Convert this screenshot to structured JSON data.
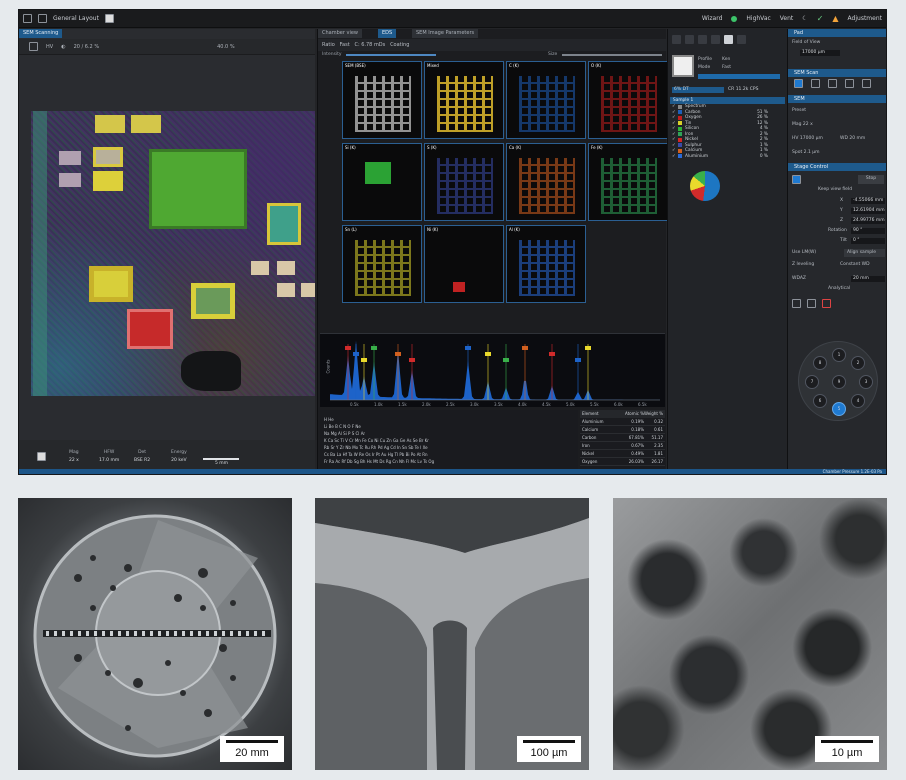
{
  "app": {
    "layout_label": "General Layout",
    "wizard_label": "Wizard",
    "highvac_label": "HighVac",
    "vent_label": "Vent",
    "adjustment_label": "Adjustment",
    "tabs": {
      "sem_scanning": "SEM Scanning",
      "chamber_view": "Chamber view",
      "eds": "EDS",
      "sem_image_params": "SEM Image Parameters"
    },
    "left_toolbar": {
      "hv_label": "HV",
      "magnification": "40.0 %",
      "spot": "20 / 6.2 %"
    },
    "left_status": [
      {
        "label": "Mag",
        "value": "22 x"
      },
      {
        "label": "HFW",
        "value": "17.0 mm"
      },
      {
        "label": "Det",
        "value": "BSE R2"
      },
      {
        "label": "Energy",
        "value": "20 keV"
      }
    ],
    "left_scalebar": "5 mm",
    "middle_toolbar": {
      "items": [
        "Ratio",
        "Fast",
        "C: 6.78 mDs",
        "Coating"
      ],
      "intensity_label": "Intensity",
      "size_label": "Size"
    },
    "map_tiles": [
      {
        "label": "SEM (BSE)",
        "color": "#9a9a9a"
      },
      {
        "label": "Mixed",
        "color": "#c9a92a"
      },
      {
        "label": "C (K)",
        "color": "#1f5fb8"
      },
      {
        "label": "O (K)",
        "color": "#c21e1e"
      },
      {
        "label": "Si (K)",
        "color": "#2fb338"
      },
      {
        "label": "S (K)",
        "color": "#3a4aa8"
      },
      {
        "label": "Ca (K)",
        "color": "#d2601f"
      },
      {
        "label": "Fe (K)",
        "color": "#2fa358"
      },
      {
        "label": "Sn (L)",
        "color": "#d9d02a"
      },
      {
        "label": "Ni (K)",
        "color": "#d42525"
      },
      {
        "label": "Al (K)",
        "color": "#2a6ad8"
      }
    ],
    "spectrum_ylabel": "Counts",
    "spectrum_ticks": [
      "0.5k",
      "1.0k",
      "1.5k",
      "2.0k",
      "2.5k",
      "3.0k",
      "3.5k",
      "4.0k",
      "4.5k",
      "5.0k",
      "5.5k",
      "6.0k",
      "6.5k"
    ],
    "periodic_rows": [
      "H He",
      "Li Be B C N O F Ne",
      "Na Mg Al Si P S Cl Ar",
      "K Ca Sc Ti V Cr Mn Fe Co Ni Cu Zn Ga Ge As Se Br Kr",
      "Rb Sr Y Zr Nb Mo Tc Ru Rh Pd Ag Cd In Sn Sb Te I Xe",
      "Cs Ba La Hf Ta W Re Os Ir Pt Au Hg Tl Pb Bi Po At Rn",
      "Fr Ra Ac Rf Db Sg Bh Hs Mt Ds Rg Cn Nh Fl Mc Lv Ts Og",
      "La Ce Pr Nd Pm Sm Eu Gd Tb Dy Ho Er Tm Yb Lu",
      "Ac Th Pa U Np Pu Am Cm Bk Cf Es Fm Md No Lr"
    ],
    "quant_table": {
      "headers": [
        "Element",
        "Atomic %",
        "Weight %"
      ],
      "rows": [
        [
          "Aluminium",
          "0.19%",
          "0.32"
        ],
        [
          "Calcium",
          "0.18%",
          "0.61"
        ],
        [
          "Carbon",
          "67.81%",
          "51.17"
        ],
        [
          "Iron",
          "0.67%",
          "2.35"
        ],
        [
          "Nickel",
          "0.49%",
          "1.81"
        ],
        [
          "Oxygen",
          "26.03%",
          "26.17"
        ]
      ]
    },
    "results": {
      "profile_label": "Profile",
      "profile_value": "Ken",
      "mode_label": "Mode",
      "mode_value": "Fast",
      "dt_label": "6% DT",
      "cr_label": "CR 11.2k CPS",
      "sample_label": "Sample 1",
      "elements": [
        {
          "name": "Spectrum",
          "color": "#888888",
          "pct": ""
        },
        {
          "name": "Carbon",
          "color": "#1f5fb8",
          "pct": "51 %"
        },
        {
          "name": "Oxygen",
          "color": "#c21e1e",
          "pct": "26 %"
        },
        {
          "name": "Tin",
          "color": "#d9d02a",
          "pct": "12 %"
        },
        {
          "name": "Silicon",
          "color": "#2fb338",
          "pct": "4 %"
        },
        {
          "name": "Iron",
          "color": "#2fa358",
          "pct": "2 %"
        },
        {
          "name": "Nickel",
          "color": "#d42525",
          "pct": "2 %"
        },
        {
          "name": "Sulphur",
          "color": "#3a4aa8",
          "pct": "1 %"
        },
        {
          "name": "Calcium",
          "color": "#d2601f",
          "pct": "1 %"
        },
        {
          "name": "Aluminium",
          "color": "#2a6ad8",
          "pct": "0 %"
        }
      ]
    },
    "controls": {
      "pad_label": "Pad",
      "fov_label": "Field of View",
      "fov_value": "17000 µm",
      "sem_scan_label": "SEM Scan",
      "sem_label": "SEM",
      "preset_label": "Preset",
      "mag_label": "Mag 22 x",
      "hv_label": "HV 17000 µm",
      "spot_label": "Spot 2.1 µm",
      "wd_label": "WD 20 mm",
      "stage_label": "Stage Control",
      "keep_label": "Keep view field",
      "stop_label": "Stop",
      "x_label": "X",
      "x_value": "-4.55066 mm",
      "y_label": "Y",
      "y_value": "12.61904 mm",
      "z_label": "Z",
      "z_value": "24.99776 mm",
      "rot_label": "Rotation",
      "rot_value": "90 °",
      "tilt_label": "Tilt",
      "tilt_value": "0 °",
      "use_label": "Use LM(W)",
      "align_label": "Align sample",
      "zlevel_label": "Z leveling",
      "cwd_label": "Constant WD",
      "wd2_label": "WDAZ",
      "wd2_value": "20 mm",
      "analytical_label": "Analytical",
      "holes": [
        "1",
        "2",
        "3",
        "4",
        "5",
        "6",
        "7",
        "8",
        "9"
      ]
    },
    "status_text": "Chamber Pressure   1.2E-03 Pa"
  },
  "samples": [
    {
      "scale_label": "20 mm"
    },
    {
      "scale_label": "100 µm"
    },
    {
      "scale_label": "10 µm"
    }
  ]
}
